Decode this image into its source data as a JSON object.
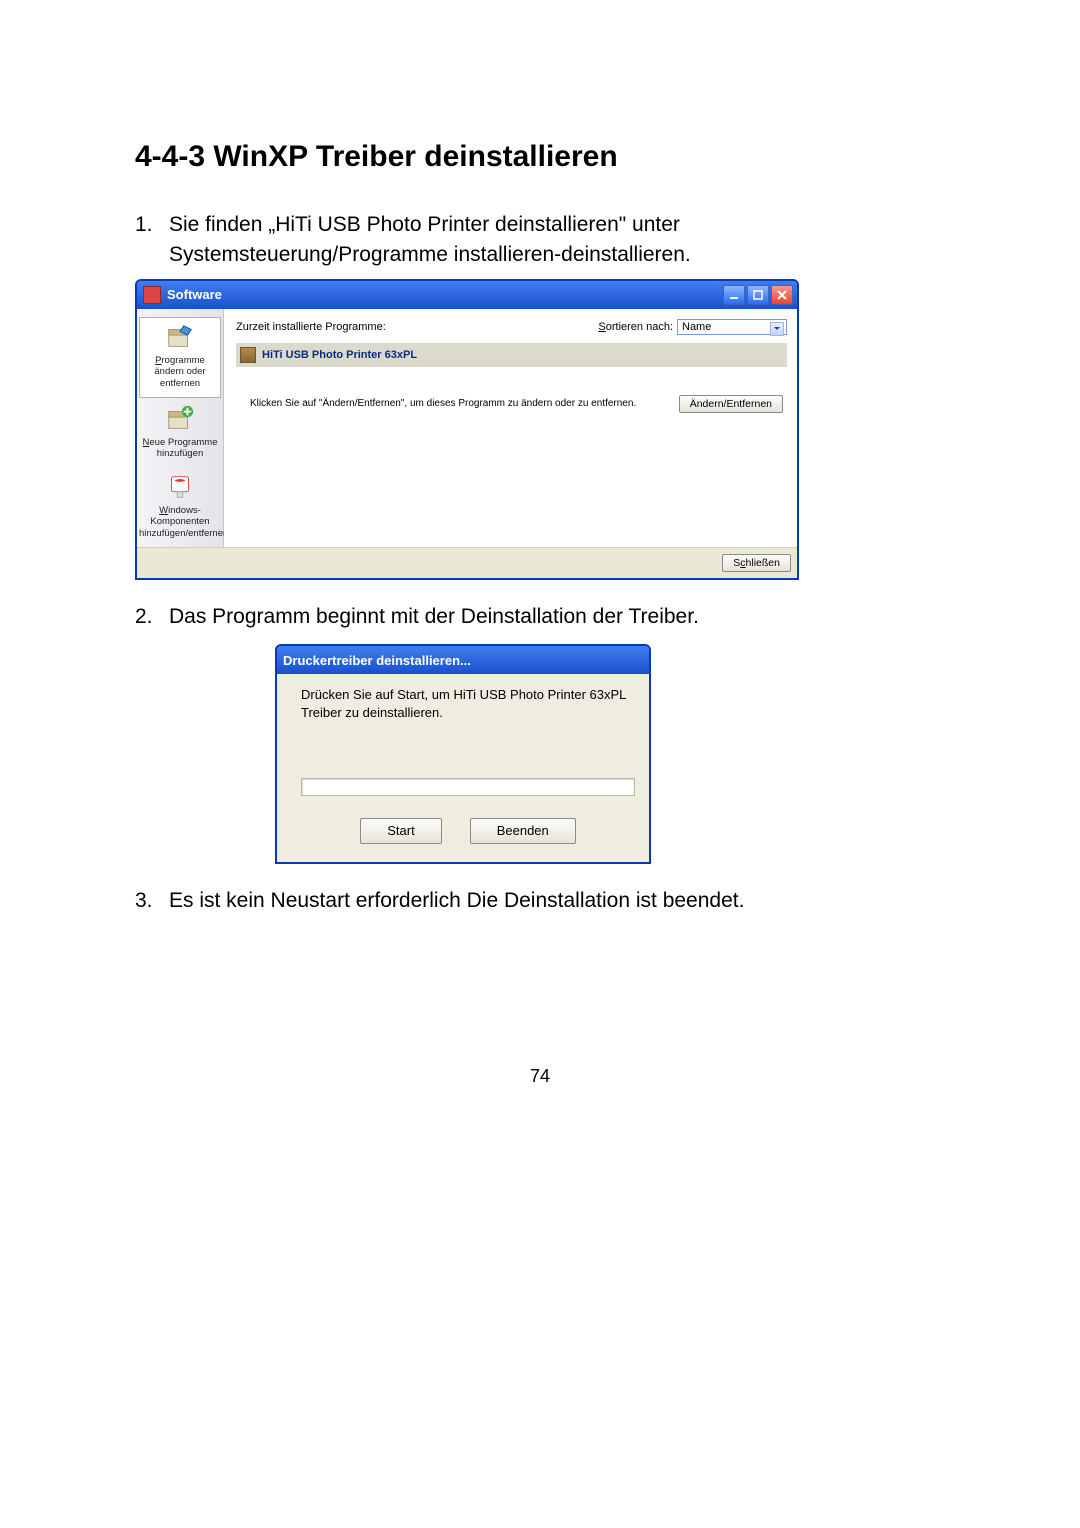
{
  "heading": "4-4-3 WinXP Treiber deinstallieren",
  "steps": {
    "s1_num": "1.",
    "s1_txt": "Sie finden „HiTi USB Photo Printer deinstallieren\" unter Systemsteuerung/Programme installieren-deinstallieren.",
    "s2_num": "2.",
    "s2_txt": "Das Programm beginnt mit der Deinstallation der Treiber.",
    "s3_num": "3.",
    "s3_txt": "Es ist kein Neustart erforderlich    Die Deinstallation ist beendet."
  },
  "software_window": {
    "title": "Software",
    "sidebar": {
      "item1": "Programme ändern oder entfernen",
      "item2": "Neue Programme hinzufügen",
      "item3": "Windows-Komponenten hinzufügen/entfernen"
    },
    "content": {
      "list_label": "Zurzeit installierte Programme:",
      "sort_label": "Sortieren nach:",
      "sort_value": "Name",
      "program_name": "HiTi USB Photo Printer 63xPL",
      "hint": "Klicken Sie auf \"Ändern/Entfernen\", um dieses Programm zu ändern oder zu entfernen.",
      "change_remove_btn": "Ändern/Entfernen",
      "close_btn": "Schließen"
    }
  },
  "uninstall_dialog": {
    "title": "Druckertreiber deinstallieren...",
    "body": "Drücken Sie auf Start, um HiTi USB Photo Printer 63xPL Treiber zu deinstallieren.",
    "start_btn": "Start",
    "quit_btn": "Beenden"
  },
  "page_number": "74"
}
